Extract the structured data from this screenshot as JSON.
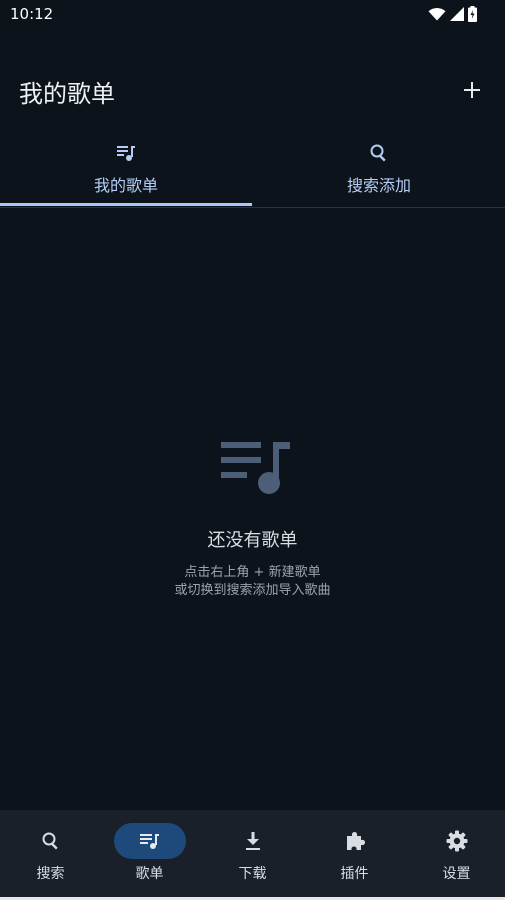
{
  "status_bar": {
    "time": "10:12"
  },
  "header": {
    "title": "我的歌单"
  },
  "tabs": [
    {
      "label": "我的歌单",
      "icon": "playlist-music-icon",
      "active": true
    },
    {
      "label": "搜索添加",
      "icon": "search-icon",
      "active": false
    }
  ],
  "empty_state": {
    "icon": "playlist-music-icon",
    "title": "还没有歌单",
    "hint_line1": "点击右上角 + 新建歌单",
    "hint_line2": "或切换到搜索添加导入歌曲"
  },
  "bottom_nav": [
    {
      "label": "搜索",
      "icon": "search-icon",
      "active": false
    },
    {
      "label": "歌单",
      "icon": "playlist-music-icon",
      "active": true
    },
    {
      "label": "下载",
      "icon": "download-icon",
      "active": false
    },
    {
      "label": "插件",
      "icon": "puzzle-icon",
      "active": false
    },
    {
      "label": "设置",
      "icon": "gear-icon",
      "active": false
    }
  ],
  "colors": {
    "background": "#0d131b",
    "accent": "#a9c7ff",
    "nav_background": "#1a2029",
    "nav_active_pill": "#1e4a7b",
    "empty_icon": "#4d5f78"
  }
}
